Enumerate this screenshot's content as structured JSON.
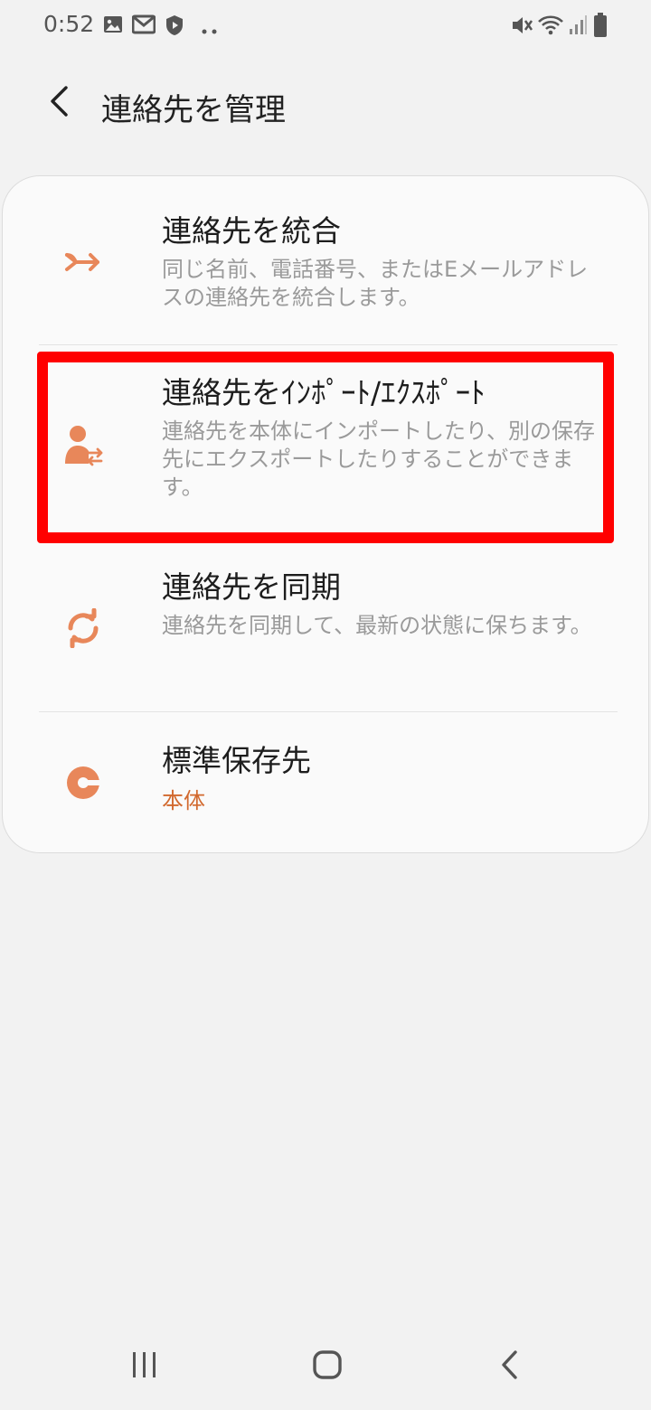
{
  "status_bar": {
    "time": "0:52",
    "left_icons": [
      "image-icon",
      "mail-icon",
      "shield-play-icon",
      "more-dots-icon"
    ],
    "right_icons": [
      "mute-vibrate-icon",
      "wifi-icon",
      "signal-icon",
      "battery-icon"
    ]
  },
  "header": {
    "title": "連絡先を管理",
    "back_icon": "chevron-left-icon"
  },
  "items": [
    {
      "title": "連絡先を統合",
      "description": "同じ名前、電話番号、またはEメールアドレスの連絡先を統合します。",
      "icon": "merge-arrow-icon"
    },
    {
      "title": "連絡先をｲﾝﾎﾟｰﾄ/ｴｸｽﾎﾟｰﾄ",
      "description": "連絡先を本体にインポートしたり、別の保存先にエクスポートしたりすることができます。",
      "icon": "person-transfer-icon",
      "highlighted": true
    },
    {
      "title": "連絡先を同期",
      "description": "連絡先を同期して、最新の状態に保ちます。",
      "icon": "sync-icon"
    },
    {
      "title": "標準保存先",
      "value": "本体",
      "icon": "storage-pie-icon"
    }
  ],
  "colors": {
    "accent": "#e8875a",
    "value_text": "#d2692e",
    "highlight": "#ff0000",
    "background": "#f2f2f2",
    "card": "#fafafa"
  },
  "nav_bar": {
    "icons": [
      "recent-apps-icon",
      "home-icon",
      "back-icon"
    ]
  }
}
